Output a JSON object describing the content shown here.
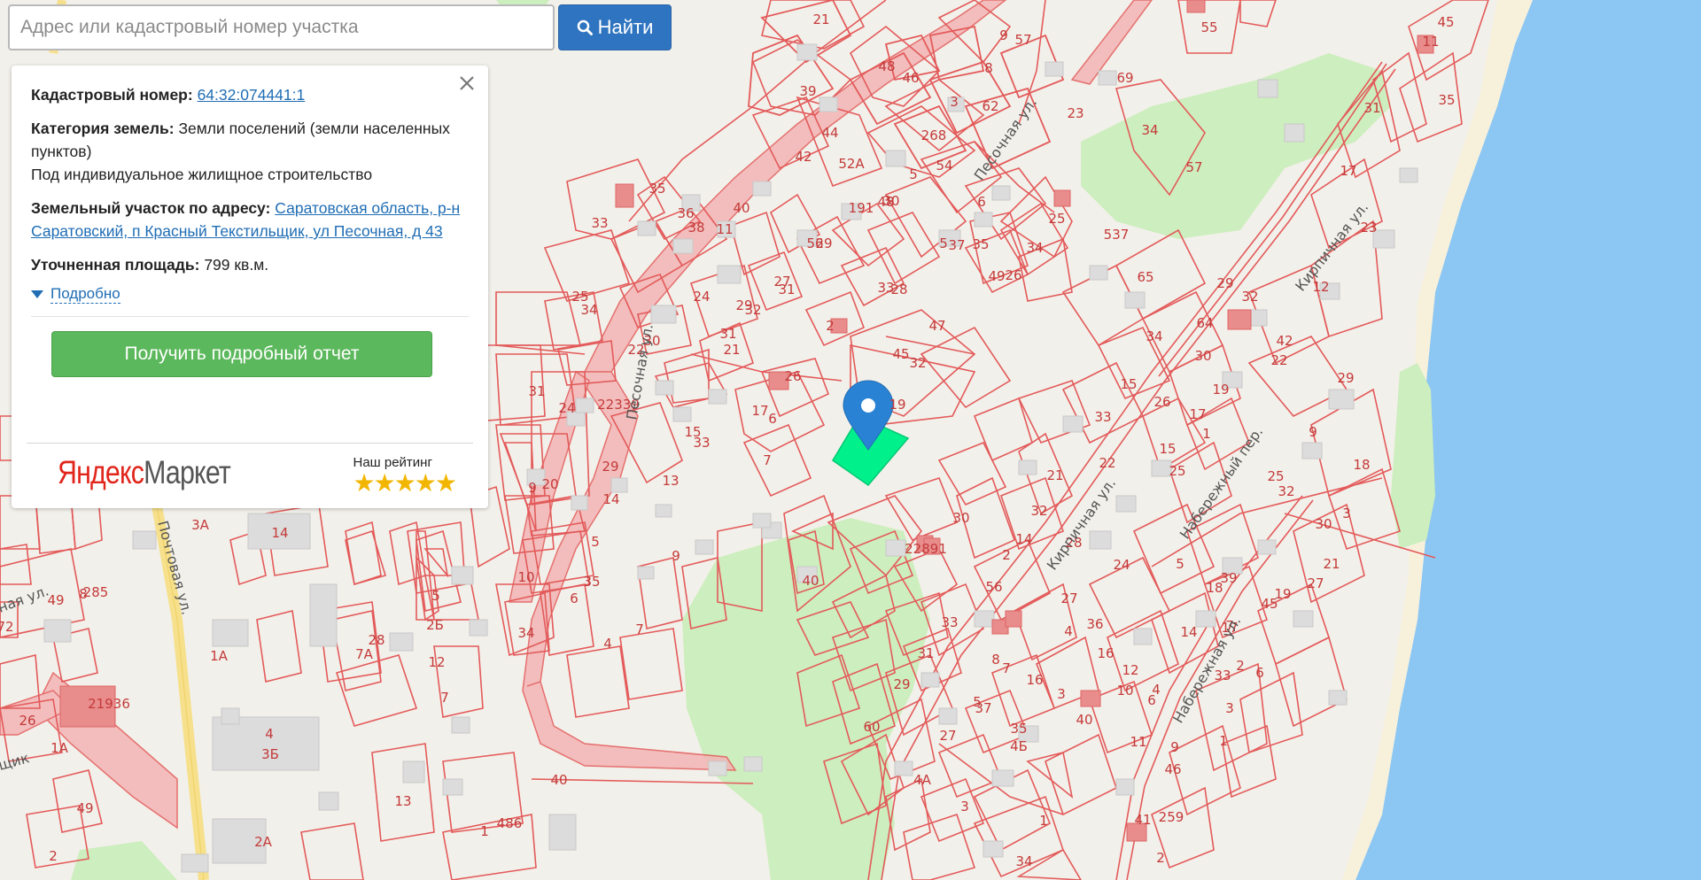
{
  "search": {
    "placeholder": "Адрес или кадастровый номер участка",
    "button_label": "Найти"
  },
  "info_panel": {
    "cadastral_label": "Кадастровый номер:",
    "cadastral_number": "64:32:074441:1",
    "land_category_label": "Категория земель:",
    "land_category_value": "Земли поселений (земли населенных пунктов)",
    "land_use": "Под индивидуальное жилищное строительство",
    "address_label": "Земельный участок по адресу:",
    "address_value": "Саратовская область, р-н Саратовский, п Красный Текстильщик, ул Песочная, д 43",
    "area_label": "Уточненная площадь:",
    "area_value": "799 кв.м.",
    "details_link": "Подробно",
    "report_button": "Получить подробный отчет"
  },
  "footer": {
    "market_logo_yandex": "Яндекс",
    "market_logo_market": "Маркет",
    "rating_label": "Наш рейтинг",
    "rating_stars": "★★★★★"
  },
  "map": {
    "colors": {
      "background": "#f2f0ea",
      "parcel_stroke": "#e35a5a",
      "water": "#8cc6f2",
      "park": "#cdeebe",
      "selected_parcel": "#00f08c",
      "marker": "#2a82d4"
    },
    "street_labels": [
      "Песочная ул.",
      "Кирпичная ул.",
      "Набережная ул.",
      "Набережный пер.",
      "Почтовая ул.",
      "Песочная ул.",
      "ная ул.",
      "щик"
    ],
    "parcel_numbers": [
      "21",
      "39",
      "48",
      "46",
      "44",
      "3",
      "8",
      "9",
      "57",
      "62",
      "268",
      "52А",
      "54",
      "42",
      "5",
      "191",
      "48",
      "40",
      "34",
      "35",
      "33",
      "36",
      "38",
      "11",
      "56",
      "29",
      "37",
      "6",
      "30",
      "5",
      "35",
      "33",
      "28",
      "27",
      "31",
      "24",
      "32",
      "29",
      "31",
      "21",
      "2",
      "47",
      "45",
      "32",
      "25",
      "34",
      "26",
      "22",
      "30",
      "19",
      "31",
      "24",
      "22339",
      "15",
      "33",
      "17",
      "6",
      "7",
      "29",
      "14",
      "13",
      "9",
      "20",
      "5",
      "35",
      "6",
      "10",
      "34",
      "9",
      "7",
      "4",
      "40",
      "60",
      "29",
      "31",
      "33",
      "30",
      "22891",
      "55",
      "69",
      "23",
      "34",
      "57",
      "25",
      "537",
      "26",
      "49",
      "65",
      "29",
      "32",
      "64",
      "30",
      "34",
      "15",
      "33",
      "26",
      "19",
      "17",
      "1",
      "15",
      "25",
      "22",
      "21",
      "32",
      "14",
      "2",
      "28",
      "56",
      "27",
      "4",
      "36",
      "24",
      "5",
      "18",
      "39",
      "14",
      "16",
      "12",
      "4",
      "6",
      "10",
      "3",
      "40",
      "35",
      "4Б",
      "37",
      "5",
      "16",
      "7",
      "8",
      "11",
      "9",
      "46",
      "41",
      "259",
      "1",
      "2",
      "34",
      "3",
      "4А",
      "27",
      "45",
      "11",
      "35",
      "31",
      "17",
      "23",
      "12",
      "42",
      "22",
      "29",
      "9",
      "18",
      "25",
      "32",
      "30",
      "3",
      "21",
      "27",
      "19",
      "45",
      "17",
      "33",
      "7",
      "2",
      "6",
      "3",
      "1",
      "3А",
      "14",
      "1А",
      "7А",
      "28",
      "12",
      "7",
      "5",
      "2Б",
      "4",
      "3Б",
      "13",
      "2А",
      "1",
      "486",
      "40",
      "21936",
      "26",
      "1А",
      "49",
      "2",
      "49",
      "8",
      "285",
      "72"
    ]
  }
}
